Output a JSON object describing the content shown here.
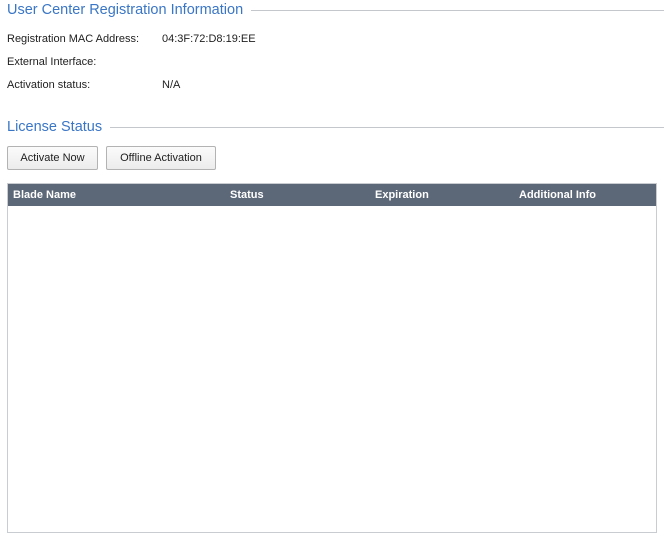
{
  "registration": {
    "title": "User Center Registration Information",
    "rows": [
      {
        "label": "Registration MAC Address:",
        "value": "04:3F:72:D8:19:EE"
      },
      {
        "label": "External Interface:",
        "value": ""
      },
      {
        "label": "Activation status:",
        "value": "N/A"
      }
    ]
  },
  "license": {
    "title": "License Status",
    "buttons": {
      "activate_now": "Activate Now",
      "offline_activation": "Offline Activation"
    },
    "table": {
      "columns": [
        "Blade Name",
        "Status",
        "Expiration",
        "Additional Info"
      ],
      "rows": []
    }
  },
  "colors": {
    "section_title": "#3a76c6",
    "table_header_bg": "#5c6778",
    "table_header_text": "#ffffff"
  }
}
